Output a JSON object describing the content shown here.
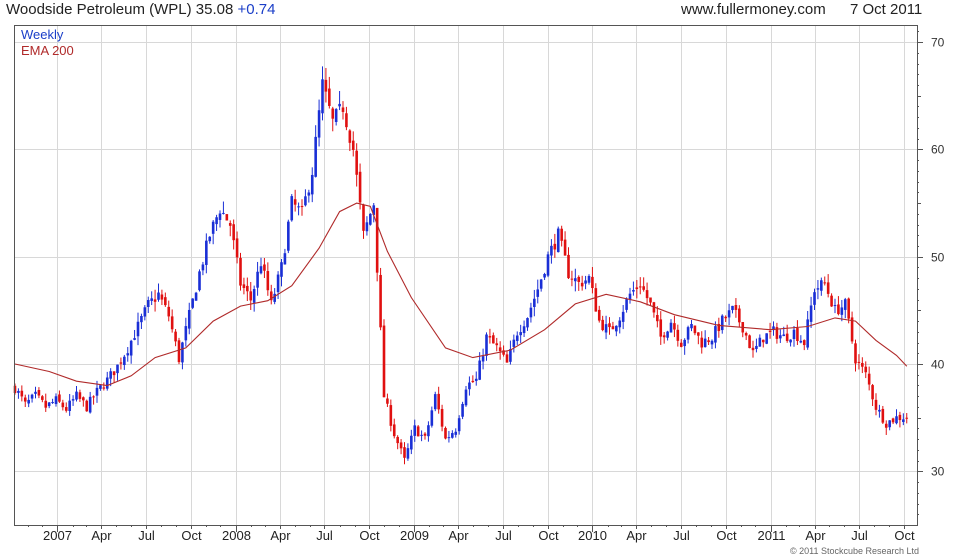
{
  "header": {
    "title": "Woodside Petroleum (WPL) 35.08",
    "change": "+0.74",
    "site": "www.fullermoney.com",
    "date": "7 Oct 2011"
  },
  "legend": {
    "weekly": "Weekly",
    "ema": "EMA 200"
  },
  "copyright": "© 2011 Stockcube Research Ltd",
  "colors": {
    "up": "#1a2fd6",
    "down": "#e01010",
    "ema": "#b02a2a",
    "grid": "#d8d8d8",
    "frame": "#555555"
  },
  "chart_data": {
    "type": "candlestick",
    "y_ticks": [
      30,
      40,
      50,
      60,
      70
    ],
    "ylim": [
      25,
      71.5
    ],
    "x_tick_labels": [
      "2007",
      "Apr",
      "Jul",
      "Oct",
      "2008",
      "Apr",
      "Jul",
      "Oct",
      "2009",
      "Apr",
      "Jul",
      "Oct",
      "2010",
      "Apr",
      "Jul",
      "Oct",
      "2011",
      "Apr",
      "Jul",
      "Oct"
    ],
    "x_range": [
      "2006-10-06",
      "2011-10-28"
    ],
    "grid": true,
    "series": [
      {
        "name": "Weekly",
        "type": "candlestick",
        "sampled": true,
        "columns": [
          "date",
          "close"
        ],
        "points": [
          [
            "2006-10-06",
            37.8
          ],
          [
            "2006-10-27",
            36.2
          ],
          [
            "2006-11-17",
            37.0
          ],
          [
            "2006-12-08",
            36.0
          ],
          [
            "2006-12-29",
            36.6
          ],
          [
            "2007-01-19",
            35.8
          ],
          [
            "2007-02-09",
            37.0
          ],
          [
            "2007-03-02",
            36.0
          ],
          [
            "2007-03-23",
            37.4
          ],
          [
            "2007-04-13",
            38.5
          ],
          [
            "2007-05-04",
            39.8
          ],
          [
            "2007-05-25",
            41.5
          ],
          [
            "2007-06-15",
            43.5
          ],
          [
            "2007-07-06",
            45.5
          ],
          [
            "2007-07-27",
            46.5
          ],
          [
            "2007-08-17",
            44.5
          ],
          [
            "2007-09-07",
            40.5
          ],
          [
            "2007-09-28",
            44.5
          ],
          [
            "2007-10-19",
            48.5
          ],
          [
            "2007-11-09",
            52.0
          ],
          [
            "2007-11-30",
            54.5
          ],
          [
            "2007-12-21",
            53.0
          ],
          [
            "2008-01-11",
            47.5
          ],
          [
            "2008-02-01",
            46.0
          ],
          [
            "2008-02-22",
            49.5
          ],
          [
            "2008-03-14",
            45.5
          ],
          [
            "2008-04-04",
            49.0
          ],
          [
            "2008-04-25",
            55.0
          ],
          [
            "2008-05-16",
            54.0
          ],
          [
            "2008-06-06",
            58.0
          ],
          [
            "2008-06-27",
            66.0
          ],
          [
            "2008-07-18",
            62.5
          ],
          [
            "2008-08-08",
            64.0
          ],
          [
            "2008-08-29",
            60.0
          ],
          [
            "2008-09-19",
            52.0
          ],
          [
            "2008-10-10",
            55.0
          ],
          [
            "2008-10-31",
            37.0
          ],
          [
            "2008-11-21",
            33.5
          ],
          [
            "2008-12-12",
            31.0
          ],
          [
            "2009-01-02",
            34.0
          ],
          [
            "2009-01-23",
            33.0
          ],
          [
            "2009-02-13",
            37.0
          ],
          [
            "2009-03-06",
            33.0
          ],
          [
            "2009-03-27",
            34.0
          ],
          [
            "2009-04-17",
            38.0
          ],
          [
            "2009-05-08",
            38.5
          ],
          [
            "2009-05-29",
            42.5
          ],
          [
            "2009-06-19",
            41.5
          ],
          [
            "2009-07-10",
            40.0
          ],
          [
            "2009-07-31",
            43.0
          ],
          [
            "2009-08-21",
            44.5
          ],
          [
            "2009-09-11",
            47.0
          ],
          [
            "2009-10-02",
            50.0
          ],
          [
            "2009-10-23",
            52.0
          ],
          [
            "2009-11-13",
            48.5
          ],
          [
            "2009-12-04",
            47.5
          ],
          [
            "2009-12-25",
            48.0
          ],
          [
            "2010-01-15",
            44.0
          ],
          [
            "2010-02-05",
            43.0
          ],
          [
            "2010-02-26",
            44.5
          ],
          [
            "2010-03-19",
            46.5
          ],
          [
            "2010-04-09",
            47.5
          ],
          [
            "2010-04-30",
            45.5
          ],
          [
            "2010-05-21",
            42.5
          ],
          [
            "2010-06-11",
            44.0
          ],
          [
            "2010-07-02",
            42.0
          ],
          [
            "2010-07-23",
            43.5
          ],
          [
            "2010-08-13",
            42.0
          ],
          [
            "2010-09-03",
            42.5
          ],
          [
            "2010-09-24",
            44.0
          ],
          [
            "2010-10-15",
            45.0
          ],
          [
            "2010-11-05",
            43.5
          ],
          [
            "2010-11-26",
            41.0
          ],
          [
            "2010-12-17",
            42.5
          ],
          [
            "2011-01-07",
            43.0
          ],
          [
            "2011-01-28",
            42.5
          ],
          [
            "2011-02-18",
            43.0
          ],
          [
            "2011-03-11",
            42.0
          ],
          [
            "2011-04-01",
            47.0
          ],
          [
            "2011-04-22",
            47.5
          ],
          [
            "2011-05-13",
            45.0
          ],
          [
            "2011-06-03",
            45.5
          ],
          [
            "2011-06-24",
            40.5
          ],
          [
            "2011-07-15",
            39.0
          ],
          [
            "2011-08-05",
            36.0
          ],
          [
            "2011-08-26",
            34.5
          ],
          [
            "2011-09-16",
            35.0
          ],
          [
            "2011-10-07",
            35.08
          ]
        ]
      },
      {
        "name": "EMA 200",
        "type": "line",
        "columns": [
          "date",
          "value"
        ],
        "points": [
          [
            "2006-10-06",
            40.0
          ],
          [
            "2006-12-15",
            39.3
          ],
          [
            "2007-02-09",
            38.4
          ],
          [
            "2007-04-13",
            38.0
          ],
          [
            "2007-06-01",
            38.9
          ],
          [
            "2007-07-20",
            40.6
          ],
          [
            "2007-09-21",
            41.5
          ],
          [
            "2007-11-16",
            44.0
          ],
          [
            "2008-01-11",
            45.4
          ],
          [
            "2008-03-07",
            45.9
          ],
          [
            "2008-04-25",
            47.3
          ],
          [
            "2008-06-20",
            50.8
          ],
          [
            "2008-08-01",
            54.2
          ],
          [
            "2008-09-05",
            55.0
          ],
          [
            "2008-10-03",
            54.7
          ],
          [
            "2008-11-07",
            50.5
          ],
          [
            "2008-12-26",
            46.2
          ],
          [
            "2009-03-06",
            41.5
          ],
          [
            "2009-05-01",
            40.6
          ],
          [
            "2009-07-17",
            41.3
          ],
          [
            "2009-09-25",
            43.2
          ],
          [
            "2009-11-27",
            45.6
          ],
          [
            "2010-01-29",
            46.5
          ],
          [
            "2010-04-09",
            45.8
          ],
          [
            "2010-06-18",
            44.6
          ],
          [
            "2010-09-17",
            43.6
          ],
          [
            "2010-12-31",
            43.2
          ],
          [
            "2011-03-18",
            43.5
          ],
          [
            "2011-05-13",
            44.3
          ],
          [
            "2011-06-24",
            44.0
          ],
          [
            "2011-08-05",
            42.2
          ],
          [
            "2011-09-16",
            40.8
          ],
          [
            "2011-10-07",
            39.8
          ]
        ]
      }
    ]
  }
}
